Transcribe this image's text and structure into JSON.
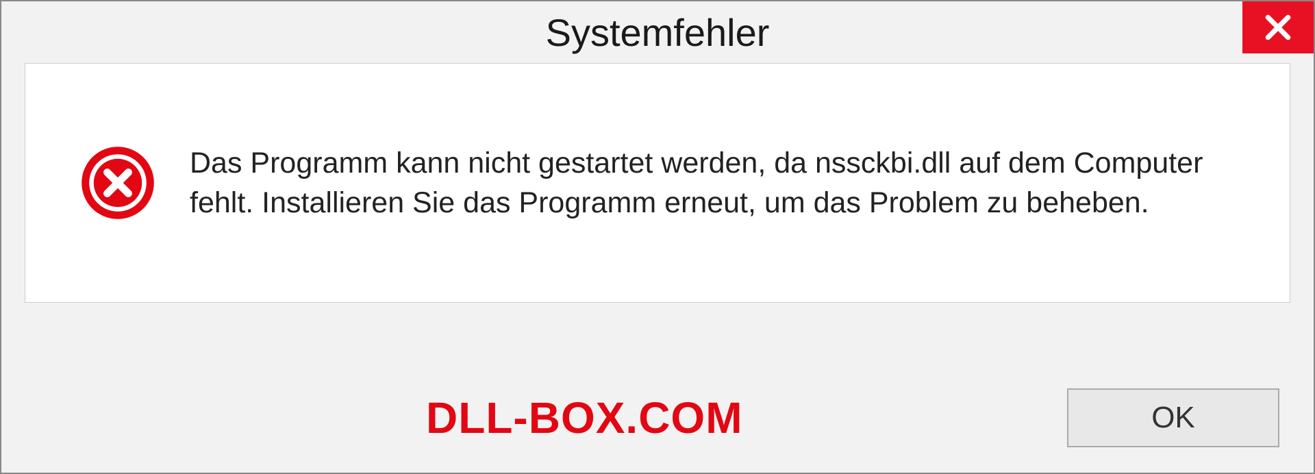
{
  "dialog": {
    "title": "Systemfehler",
    "message": "Das Programm kann nicht gestartet werden, da nssckbi.dll auf dem Computer fehlt. Installieren Sie das Programm erneut, um das Problem zu beheben.",
    "ok_label": "OK"
  },
  "watermark": "DLL-BOX.COM"
}
